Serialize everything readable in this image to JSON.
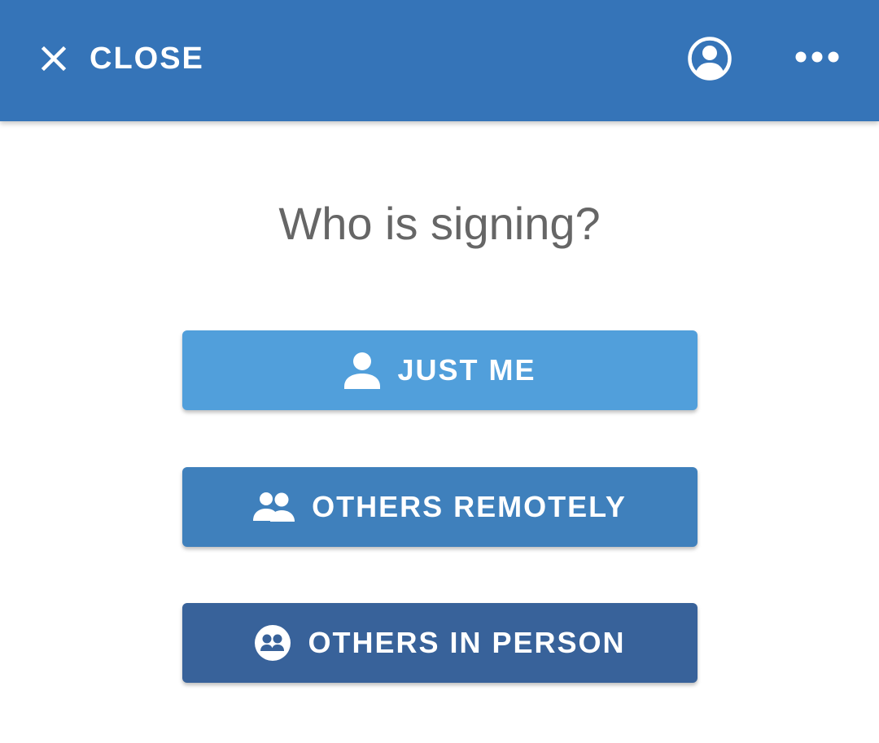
{
  "appbar": {
    "close_label": "CLOSE",
    "close_icon": "close-icon",
    "profile_icon": "account-circle-icon",
    "more_icon": "more-horizontal-icon",
    "background": "#3574b8"
  },
  "main": {
    "title": "Who is signing?",
    "options": [
      {
        "label": "JUST ME",
        "icon": "person-icon",
        "color": "#519fdb"
      },
      {
        "label": "OTHERS REMOTELY",
        "icon": "people-icon",
        "color": "#3f80bc"
      },
      {
        "label": "OTHERS IN PERSON",
        "icon": "people-in-person-icon",
        "color": "#38629a"
      }
    ]
  }
}
